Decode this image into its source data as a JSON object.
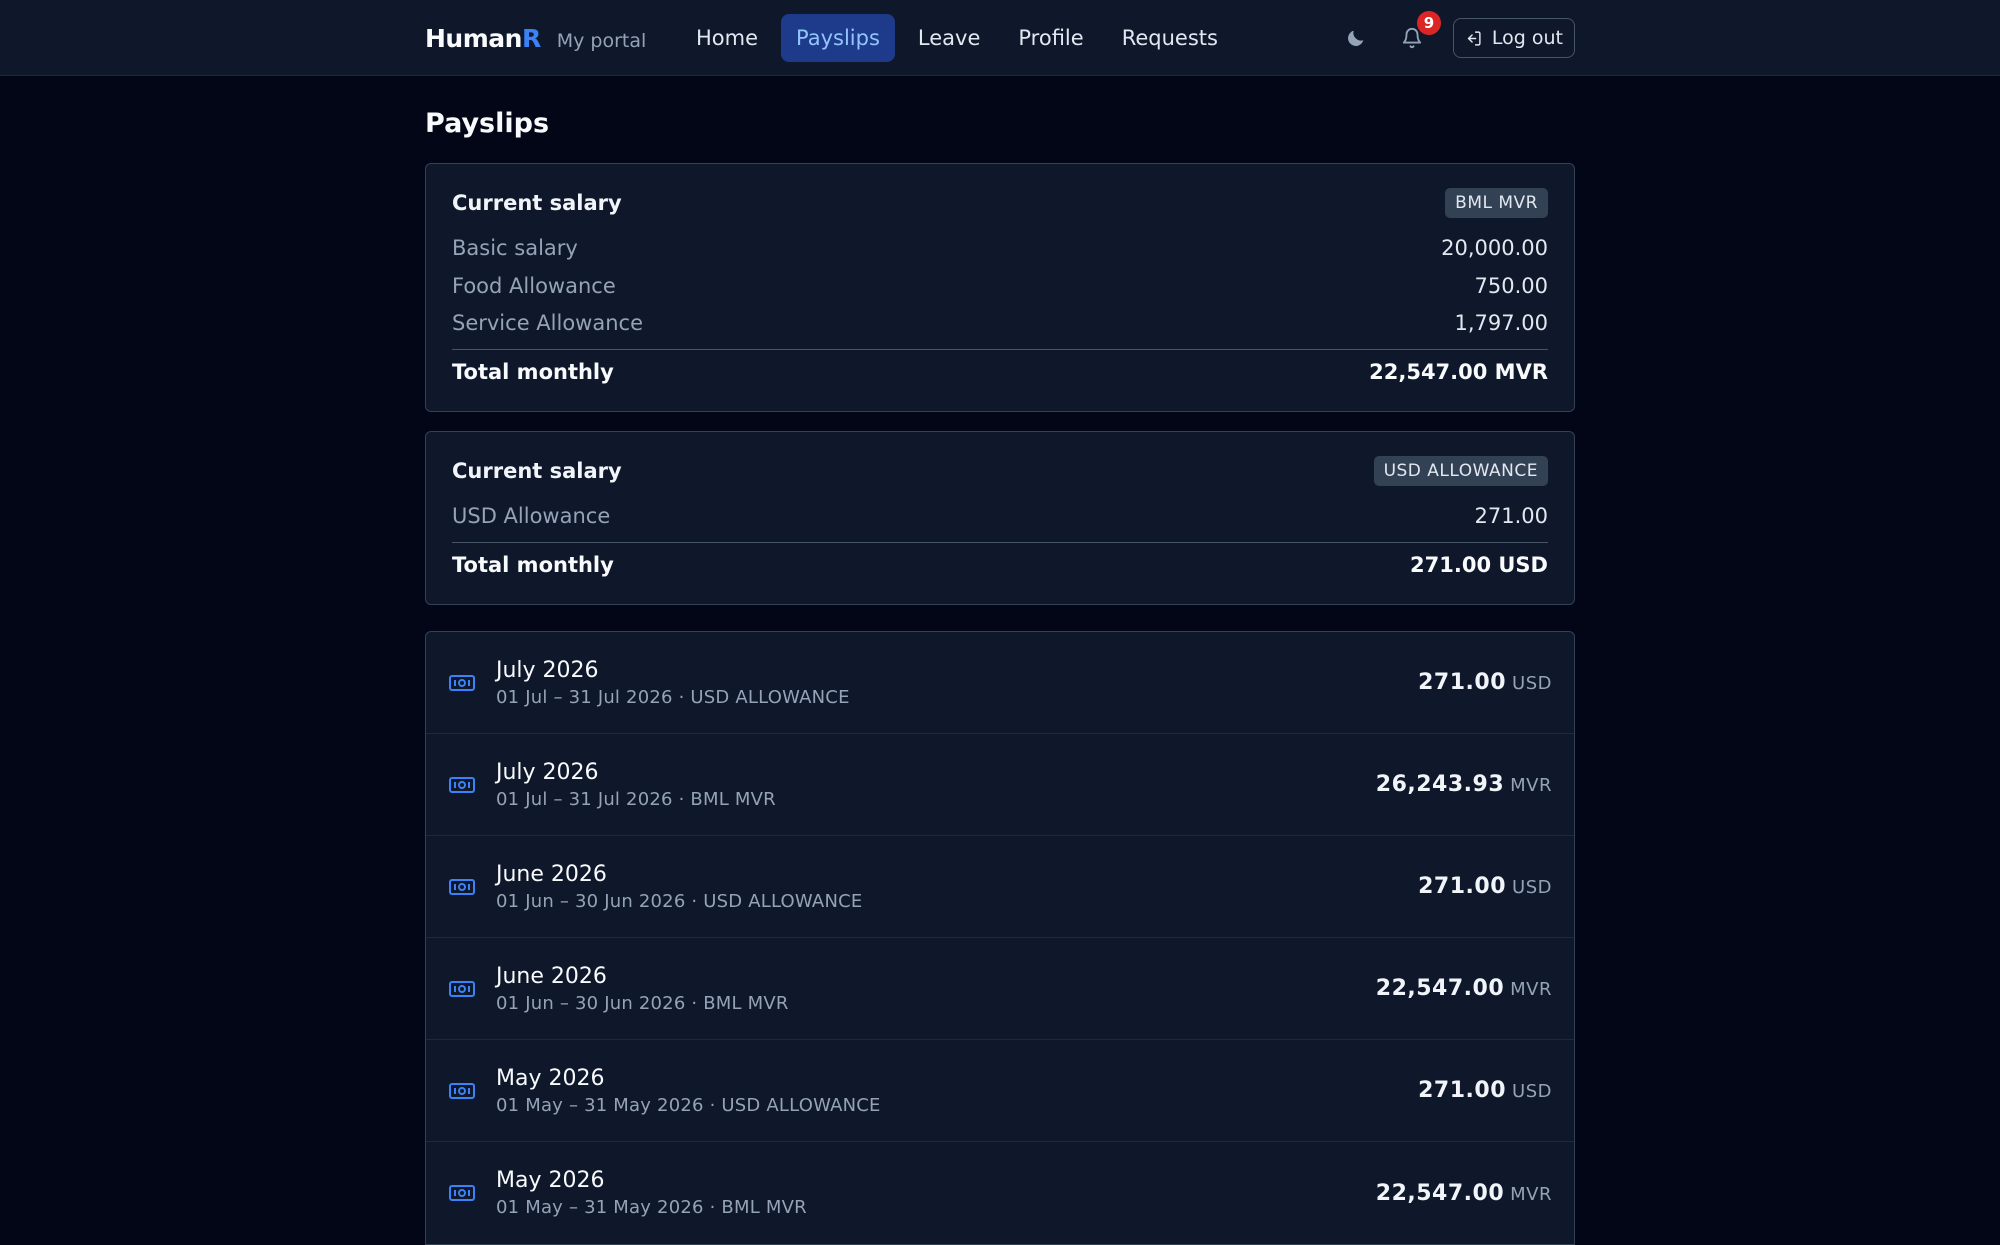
{
  "header": {
    "brand_main": "Human",
    "brand_accent": "R",
    "brand_sub": "My portal",
    "nav": [
      {
        "label": "Home",
        "active": false
      },
      {
        "label": "Payslips",
        "active": true
      },
      {
        "label": "Leave",
        "active": false
      },
      {
        "label": "Profile",
        "active": false
      },
      {
        "label": "Requests",
        "active": false
      }
    ],
    "notification_count": "9",
    "logout_label": "Log out",
    "icons": {
      "theme": "moon-icon",
      "notifications": "bell-icon",
      "logout": "logout-icon"
    }
  },
  "page": {
    "title": "Payslips"
  },
  "salary_cards": [
    {
      "title": "Current salary",
      "badge": "BML MVR",
      "rows": [
        {
          "label": "Basic salary",
          "value": "20,000.00"
        },
        {
          "label": "Food Allowance",
          "value": "750.00"
        },
        {
          "label": "Service Allowance",
          "value": "1,797.00"
        }
      ],
      "total_label": "Total monthly",
      "total_value": "22,547.00 MVR"
    },
    {
      "title": "Current salary",
      "badge": "USD ALLOWANCE",
      "rows": [
        {
          "label": "USD Allowance",
          "value": "271.00"
        }
      ],
      "total_label": "Total monthly",
      "total_value": "271.00 USD"
    }
  ],
  "payslips": [
    {
      "title": "July 2026",
      "subtitle": "01 Jul – 31 Jul 2026 · USD ALLOWANCE",
      "amount": "271.00",
      "currency": "USD"
    },
    {
      "title": "July 2026",
      "subtitle": "01 Jul – 31 Jul 2026 · BML MVR",
      "amount": "26,243.93",
      "currency": "MVR"
    },
    {
      "title": "June 2026",
      "subtitle": "01 Jun – 30 Jun 2026 · USD ALLOWANCE",
      "amount": "271.00",
      "currency": "USD"
    },
    {
      "title": "June 2026",
      "subtitle": "01 Jun – 30 Jun 2026 · BML MVR",
      "amount": "22,547.00",
      "currency": "MVR"
    },
    {
      "title": "May 2026",
      "subtitle": "01 May – 31 May 2026 · USD ALLOWANCE",
      "amount": "271.00",
      "currency": "USD"
    },
    {
      "title": "May 2026",
      "subtitle": "01 May – 31 May 2026 · BML MVR",
      "amount": "22,547.00",
      "currency": "MVR"
    }
  ],
  "colors": {
    "accent": "#3b82f6",
    "background": "#020617",
    "card": "#0f172a",
    "badge_notification": "#dc2626"
  }
}
